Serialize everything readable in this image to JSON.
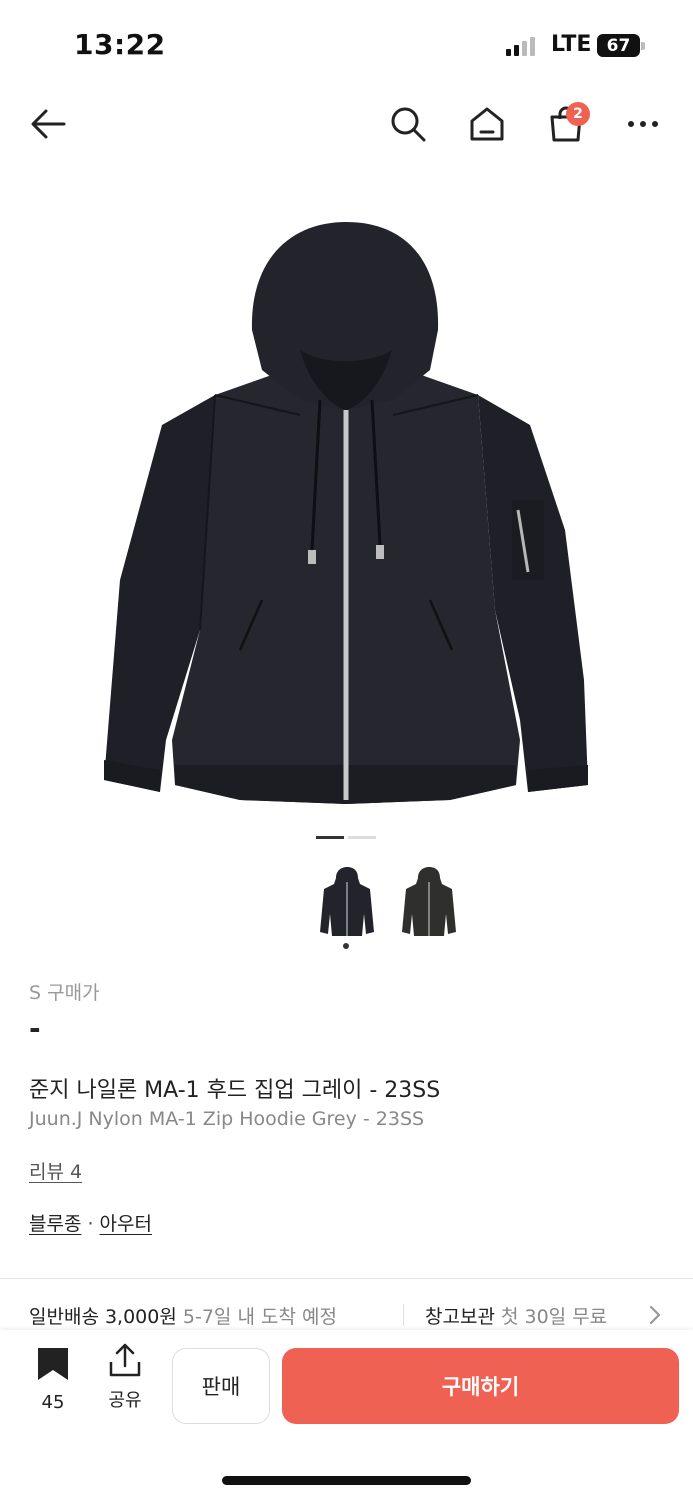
{
  "status_bar": {
    "time": "13:22",
    "network": "LTE",
    "battery": "67"
  },
  "nav": {
    "cart_count": "2"
  },
  "gallery": {
    "active_index": 1,
    "total": 2
  },
  "product": {
    "size_label": "S 구매가",
    "price": "-",
    "name_ko": "준지 나일론 MA-1 후드 집업 그레이 - 23SS",
    "name_en": "Juun.J Nylon MA-1 Zip Hoodie Grey - 23SS",
    "review_link": "리뷰 4",
    "category_1": "블루종",
    "category_sep": "·",
    "category_2": "아우터"
  },
  "shipping": {
    "label": "일반배송 3,000원",
    "eta": "5-7일 내 도착 예정",
    "storage_label": "창고보관",
    "storage_note": "첫 30일 무료"
  },
  "bottom": {
    "bookmark_count": "45",
    "share_label": "공유",
    "sell_label": "판매",
    "buy_label": "구매하기"
  },
  "colors": {
    "accent": "#ef6253",
    "jacket": "#23242b"
  }
}
